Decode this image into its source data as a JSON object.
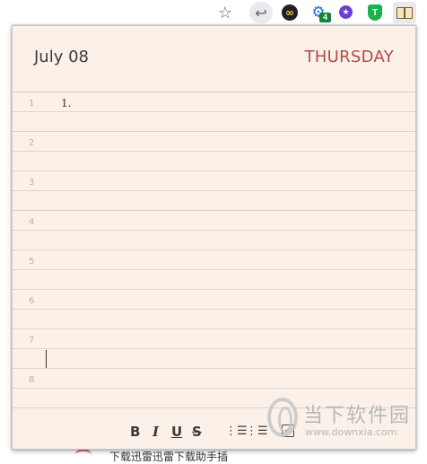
{
  "toolbar": {
    "extensions_badge": "4"
  },
  "icons": {
    "bookmark": "star-icon",
    "back": "back-arrow-icon",
    "infinity": "infinity-icon",
    "gear": "gear-icon",
    "purple_star": "purple-star-icon",
    "shield": "shield-icon",
    "notebook": "notebook-icon"
  },
  "notepad": {
    "date": "July 08",
    "day": "THURSDAY",
    "lines": [
      {
        "number": "1",
        "text": "1."
      },
      {
        "number": "",
        "text": ""
      },
      {
        "number": "2",
        "text": ""
      },
      {
        "number": "",
        "text": ""
      },
      {
        "number": "3",
        "text": ""
      },
      {
        "number": "",
        "text": ""
      },
      {
        "number": "4",
        "text": ""
      },
      {
        "number": "",
        "text": ""
      },
      {
        "number": "5",
        "text": ""
      },
      {
        "number": "",
        "text": ""
      },
      {
        "number": "6",
        "text": ""
      },
      {
        "number": "",
        "text": ""
      },
      {
        "number": "7",
        "text": ""
      },
      {
        "number": "",
        "text": ""
      },
      {
        "number": "8",
        "text": ""
      },
      {
        "number": "",
        "text": ""
      }
    ],
    "format": {
      "bold": "B",
      "italic": "I",
      "underline": "U",
      "strike": "S",
      "ordered_list": "☰",
      "bullet_list": "☰",
      "checkbox": "✓"
    }
  },
  "watermark": {
    "title": "当下软件园",
    "url": "www.downxia.com"
  },
  "background": {
    "text": "下载迅雷迅雷下载助手插"
  },
  "colors": {
    "paper": "#fbf1e8",
    "day_accent": "#b24a4a",
    "badge": "#188038"
  }
}
